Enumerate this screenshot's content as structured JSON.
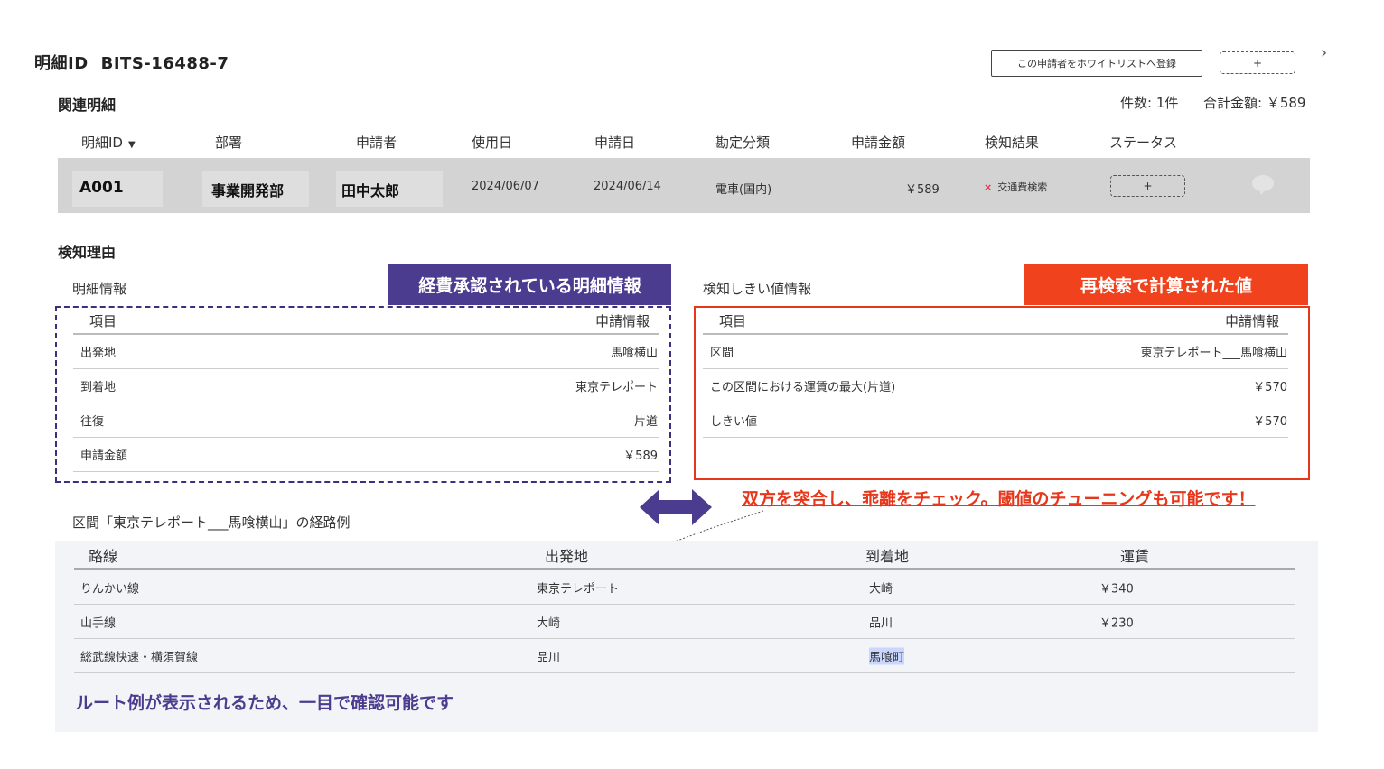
{
  "header": {
    "title_label": "明細ID",
    "title_id": "BITS-16488-7",
    "whitelist_button": "この申請者をホワイトリストへ登録",
    "plus_button": "+",
    "chevron": "›"
  },
  "related": {
    "title": "関連明細",
    "count_label": "件数: 1件",
    "total_label": "合計金額: ￥589",
    "columns": [
      "明細ID",
      "部署",
      "申請者",
      "使用日",
      "申請日",
      "勘定分類",
      "申請金額",
      "検知結果",
      "ステータス"
    ],
    "sort_caret": "▼",
    "row": {
      "id": "A001",
      "department": "事業開発部",
      "applicant": "田中太郎",
      "use_date": "2024/06/07",
      "apply_date": "2024/06/14",
      "category": "電車(国内)",
      "amount": "￥589",
      "detection_mark": "×",
      "detection": "交通費検索",
      "status_button": "+"
    }
  },
  "reason": {
    "title": "検知理由",
    "detail_title": "明細情報",
    "detail_banner": "経費承認されている明細情報",
    "detail_head": [
      "項目",
      "申請情報"
    ],
    "detail_rows": [
      {
        "k": "出発地",
        "v": "馬喰横山"
      },
      {
        "k": "到着地",
        "v": "東京テレポート"
      },
      {
        "k": "往復",
        "v": "片道"
      },
      {
        "k": "申請金額",
        "v": "￥589"
      }
    ],
    "threshold_title": "検知しきい値情報",
    "threshold_banner": "再検索で計算された値",
    "threshold_head": [
      "項目",
      "申請情報"
    ],
    "threshold_rows": [
      {
        "k": "区間",
        "v": "東京テレポート___馬喰横山"
      },
      {
        "k": "この区間における運賃の最大(片道)",
        "v": "￥570"
      },
      {
        "k": "しきい値",
        "v": "￥570"
      }
    ],
    "callout": "双方を突合し、乖離をチェック。閾値のチューニングも可能です！"
  },
  "route": {
    "title": "区間「東京テレポート___馬喰横山」の経路例",
    "columns": [
      "路線",
      "出発地",
      "到着地",
      "運賃"
    ],
    "rows": [
      {
        "line": "りんかい線",
        "from": "東京テレポート",
        "to": "大崎",
        "fare": "￥340"
      },
      {
        "line": "山手線",
        "from": "大崎",
        "to": "品川",
        "fare": "￥230"
      },
      {
        "line": "総武線快速・横須賀線",
        "from": "品川",
        "to": "馬喰町",
        "fare": ""
      }
    ],
    "note": "ルート例が表示されるため、一目で確認可能です"
  },
  "colors": {
    "purple": "#4b3c8f",
    "red": "#f0421c",
    "row_band": "#d3d3d3",
    "route_bg": "#f2f4f7"
  }
}
